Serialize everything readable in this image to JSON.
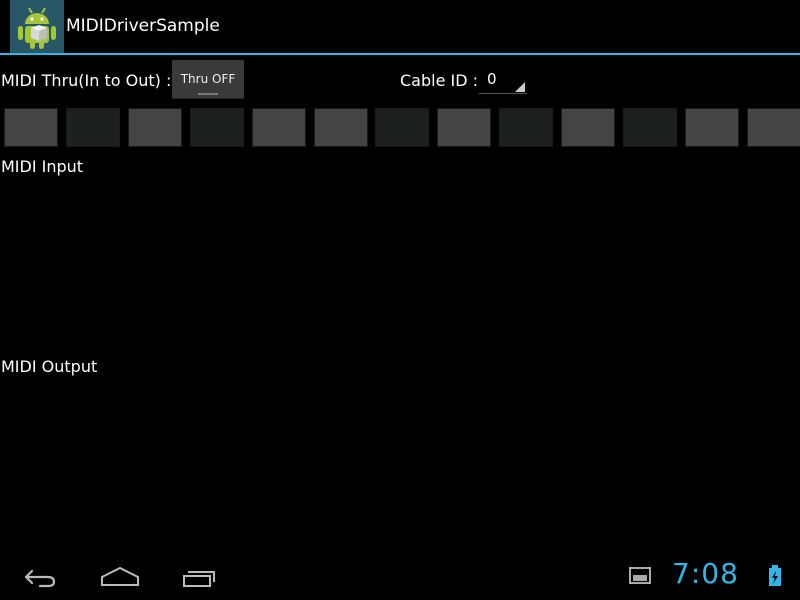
{
  "app": {
    "title": "MIDIDriverSample",
    "icon": "android-icon"
  },
  "controls": {
    "thru_label": "MIDI Thru(In to Out) :",
    "thru_button": "Thru OFF",
    "cable_label": "Cable ID :",
    "cable_value": "0"
  },
  "pads": [
    "light",
    "dark",
    "light",
    "dark",
    "light",
    "light",
    "dark",
    "light",
    "dark",
    "light",
    "dark",
    "light",
    "light"
  ],
  "sections": {
    "input_label": "MIDI Input",
    "output_label": "MIDI Output"
  },
  "status": {
    "time": "7:08",
    "accent": "#33b5e5"
  },
  "nav": {
    "icons": [
      "back-icon",
      "home-icon",
      "recent-apps-icon"
    ]
  }
}
